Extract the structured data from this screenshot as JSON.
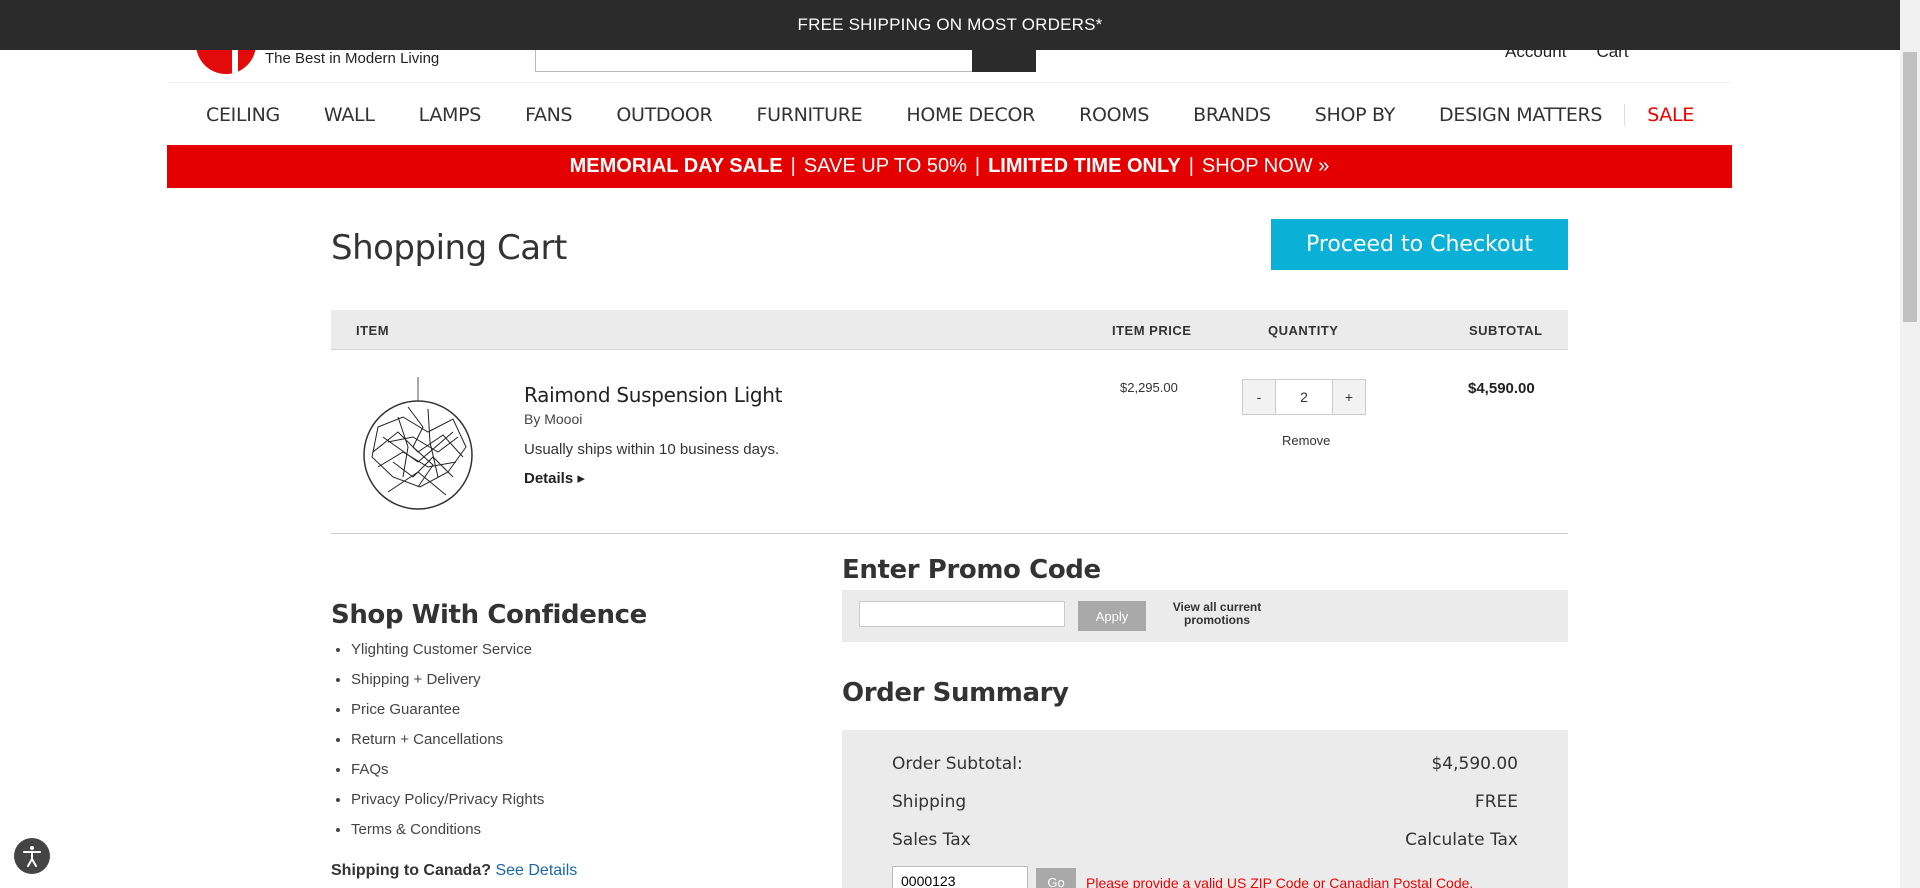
{
  "topbar": {
    "text": "FREE SHIPPING ON MOST ORDERS*"
  },
  "header": {
    "tagline": "The Best in Modern Living",
    "account_label": "Account",
    "cart_label": "Cart"
  },
  "nav": {
    "items": [
      "CEILING",
      "WALL",
      "LAMPS",
      "FANS",
      "OUTDOOR",
      "FURNITURE",
      "HOME DECOR",
      "ROOMS",
      "BRANDS",
      "SHOP BY",
      "DESIGN MATTERS",
      "SALE"
    ]
  },
  "banner": {
    "part1": "MEMORIAL DAY SALE",
    "sep": "|",
    "part2": "SAVE UP TO 50%",
    "part3": "LIMITED TIME ONLY",
    "part4": "SHOP NOW »"
  },
  "cart": {
    "title": "Shopping Cart",
    "checkout_label": "Proceed to Checkout",
    "columns": {
      "item": "ITEM",
      "price": "ITEM PRICE",
      "quantity": "QUANTITY",
      "subtotal": "SUBTOTAL"
    },
    "item": {
      "name": "Raimond Suspension Light",
      "brand": "By Moooi",
      "shipping": "Usually ships within 10 business days.",
      "details_label": "Details ▸",
      "price": "$2,295.00",
      "qty_minus": "-",
      "qty_value": "2",
      "qty_plus": "+",
      "remove_label": "Remove",
      "subtotal": "$4,590.00"
    }
  },
  "confidence": {
    "title": "Shop With Confidence",
    "items": [
      "Ylighting Customer Service",
      "Shipping + Delivery",
      "Price Guarantee",
      "Return + Cancellations",
      "FAQs",
      "Privacy Policy/Privacy Rights",
      "Terms & Conditions"
    ],
    "canada_label": "Shipping to Canada?",
    "canada_link": "See Details"
  },
  "promo": {
    "title": "Enter Promo Code",
    "input_value": "",
    "apply_label": "Apply",
    "view_label": "View all current promotions"
  },
  "summary": {
    "title": "Order Summary",
    "rows": [
      {
        "label": "Order Subtotal:",
        "value": "$4,590.00"
      },
      {
        "label": "Shipping",
        "value": "FREE"
      },
      {
        "label": "Sales Tax",
        "value": "Calculate Tax"
      }
    ],
    "zip_value": "0000123",
    "go_label": "Go",
    "zip_error": "Please provide a valid US ZIP Code or Canadian Postal Code."
  },
  "colors": {
    "accent": "#0ab0d6",
    "sale": "#e50000",
    "topbar": "#2b2b2b"
  }
}
